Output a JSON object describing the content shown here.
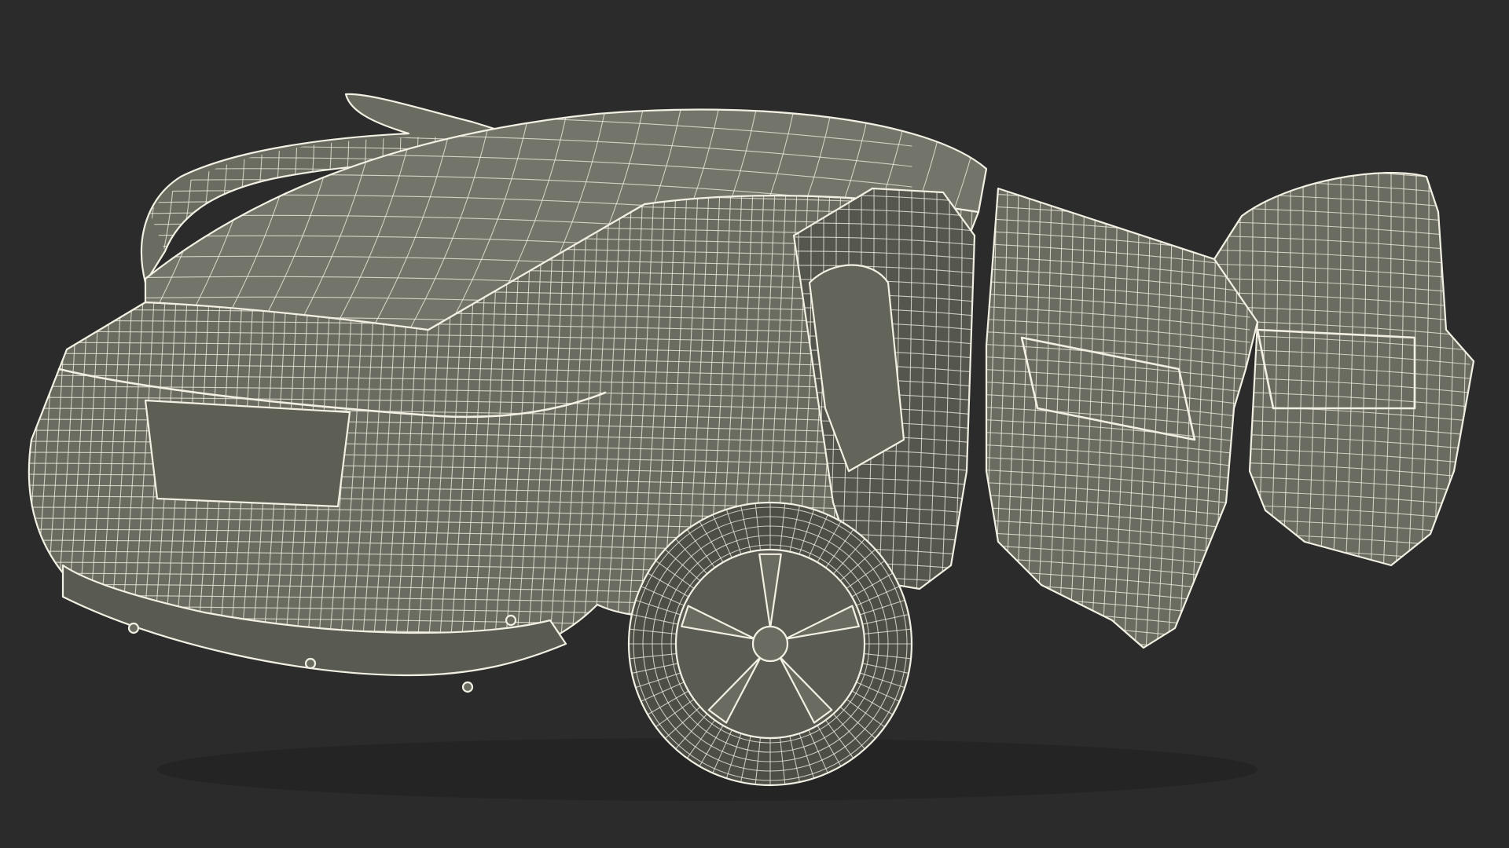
{
  "scene": {
    "background_color": "#2b2b2b",
    "mesh_fill_color": "#6b6c61",
    "mesh_shadow_color": "#4d4e46",
    "wire_color": "#f2f0e3",
    "subject": "car-wireframe-render"
  }
}
